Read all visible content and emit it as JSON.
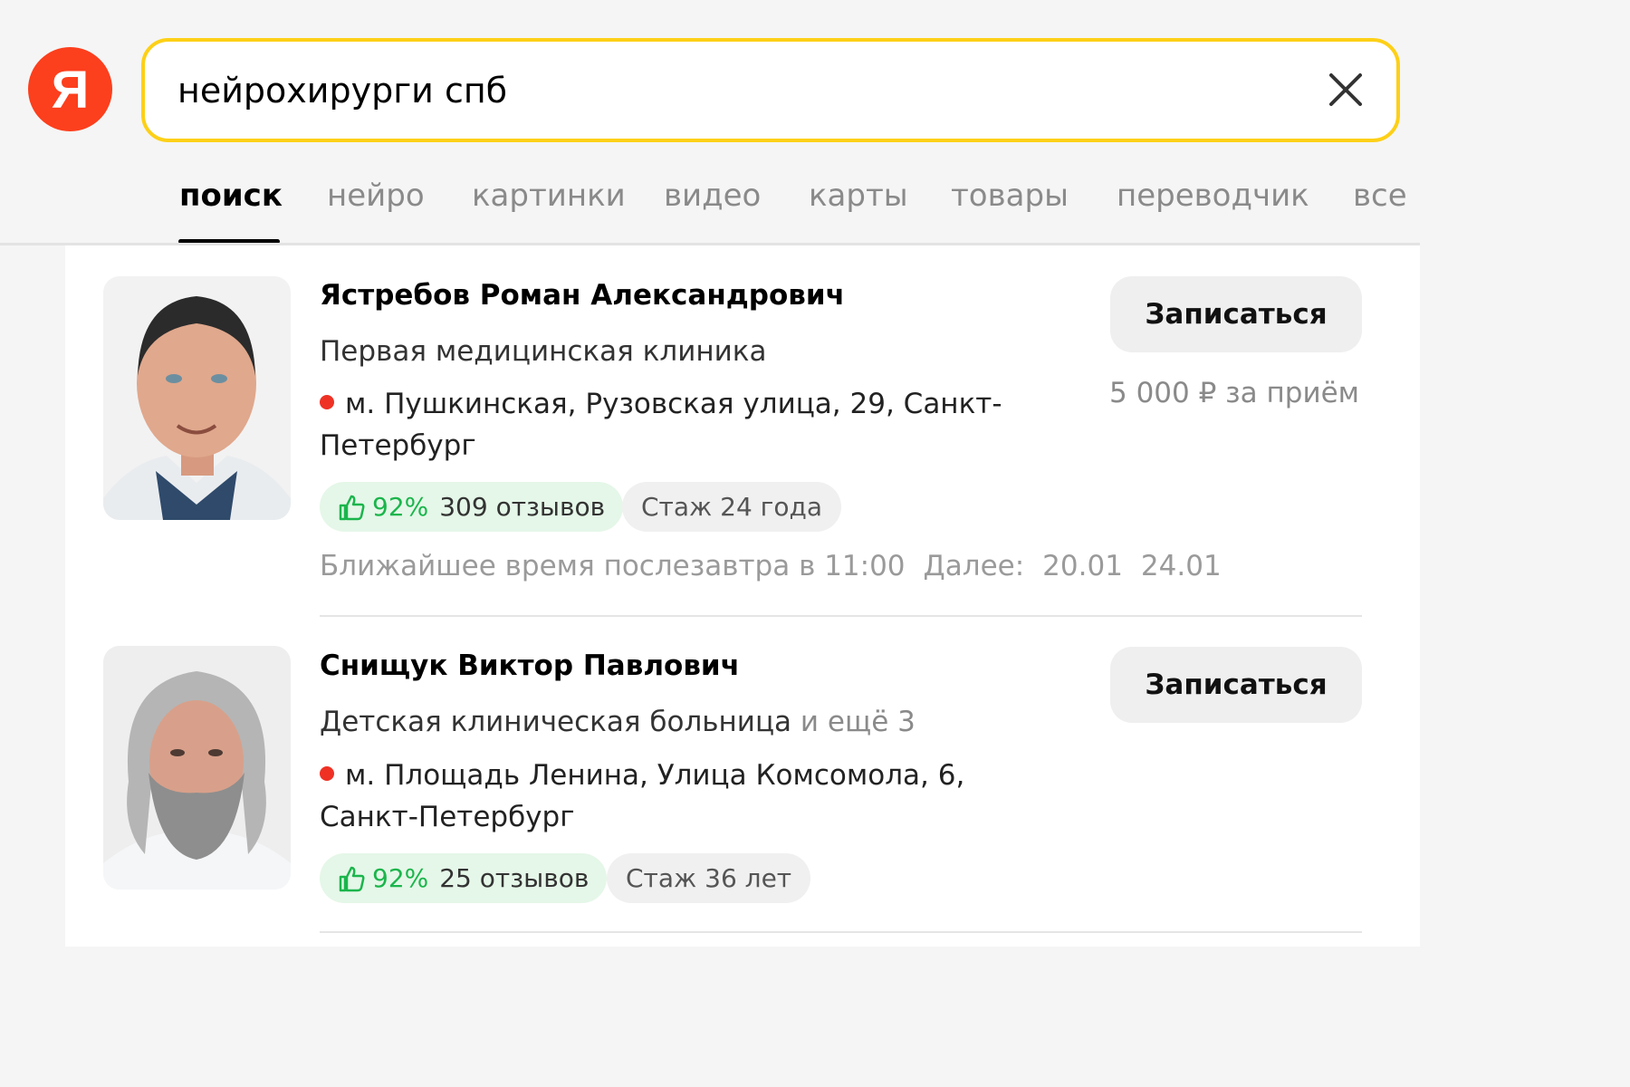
{
  "header": {
    "logo_letter": "Я",
    "search": {
      "value": "нейрохирурги спб"
    }
  },
  "tabs": [
    {
      "label": "поиск",
      "active": true
    },
    {
      "label": "нейро"
    },
    {
      "label": "картинки"
    },
    {
      "label": "видео"
    },
    {
      "label": "карты"
    },
    {
      "label": "товары"
    },
    {
      "label": "переводчик"
    },
    {
      "label": "все"
    }
  ],
  "doctors": [
    {
      "name": "Ястребов Роман Александрович",
      "clinic": "Первая медицинская клиника",
      "address": "м. Пушкинская, Рузовская улица, 29, Санкт-Петербург",
      "rating": "92%",
      "reviews": "309 отзывов",
      "experience": "Стаж 24 года",
      "book_label": "Записаться",
      "price": "5 000 ₽ за приём",
      "nearest": "Ближайшее время послезавтра в 11:00",
      "next_label": "Далее:",
      "next_dates": [
        "20.01",
        "24.01"
      ]
    },
    {
      "name": "Снищук Виктор Павлович",
      "clinic": "Детская клиническая больница",
      "clinic_more": "и ещё 3",
      "address": "м. Площадь Ленина, Улица Комсомола, 6, Санкт-Петербург",
      "rating": "92%",
      "reviews": "25 отзывов",
      "experience": "Стаж 36 лет",
      "book_label": "Записаться"
    }
  ],
  "colors": {
    "brand_red": "#fc3f1d",
    "search_border": "#fdd017",
    "rating_green": "#1bb54c",
    "metro_red": "#ef3124"
  },
  "icons": [
    "yandex-logo",
    "close-icon",
    "thumbs-up-icon",
    "metro-dot-icon"
  ]
}
